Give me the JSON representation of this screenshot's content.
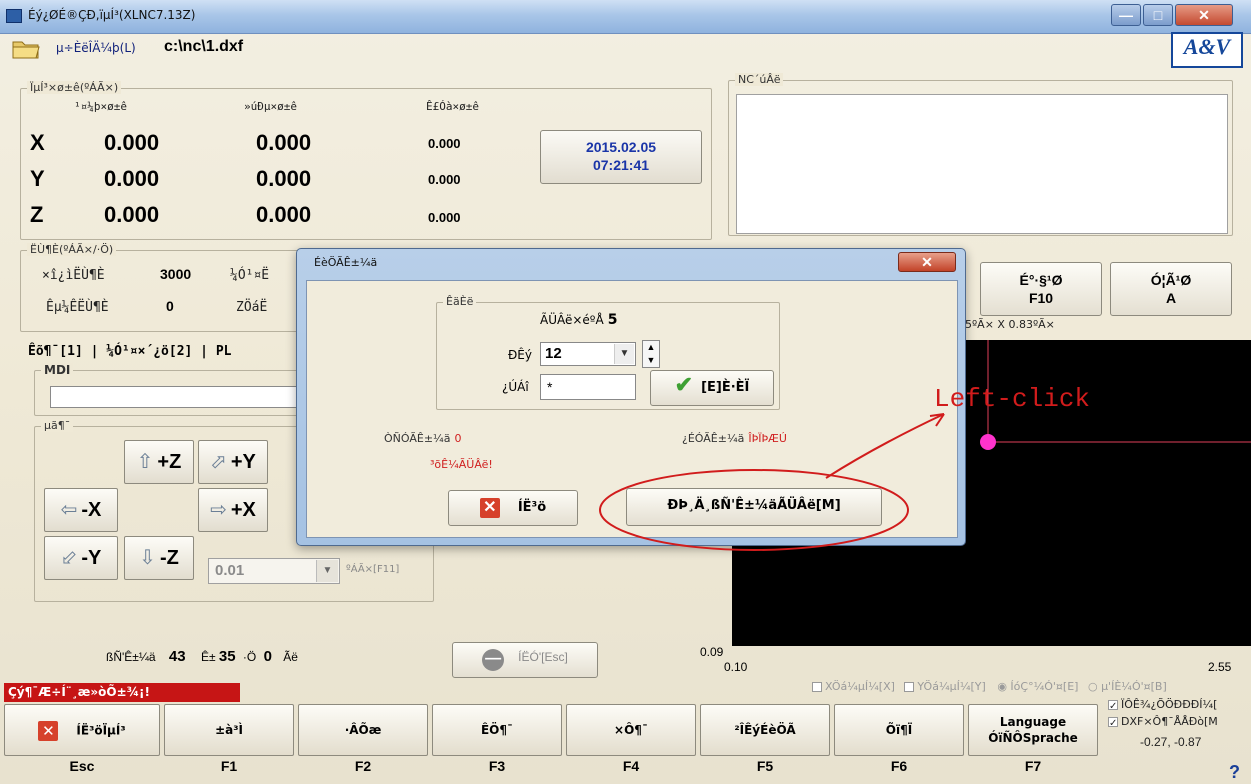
{
  "window": {
    "title": "Éý¿ØÉ®ÇÐ,ïµÍ³(XLNC7.13Z)",
    "btn_min": "—",
    "btn_max": "□",
    "btn_close": "✕"
  },
  "toolbar": {
    "open_file": "µ÷ÈëÎÄ¼þ(L)",
    "file_path": "c:\\nc\\1.dxf",
    "logo": "A&V"
  },
  "coords": {
    "group_title": "ÏµÍ³×ø±ê(ºÁÃ×)",
    "col1": "¹¤¼þ×ø±ê",
    "col2": "»úÐµ×ø±ê",
    "col3": "Ê£Óà×ø±ê",
    "rows": [
      {
        "axis": "X",
        "work": "0.000",
        "mach": "0.000",
        "remain": "0.000"
      },
      {
        "axis": "Y",
        "work": "0.000",
        "mach": "0.000",
        "remain": "0.000"
      },
      {
        "axis": "Z",
        "work": "0.000",
        "mach": "0.000",
        "remain": "0.000"
      }
    ]
  },
  "datetime": {
    "date": "2015.02.05",
    "time": "07:21:41"
  },
  "nc": {
    "group_title": "NC´úÂë",
    "code": ""
  },
  "speed": {
    "group_title": "ËÙ¶È(ºÁÃ×/·Ö)",
    "row1_label": "×î¿ìËÙ¶È",
    "row1_value": "3000",
    "row1b_label": "¼Ó¹¤Ë",
    "row2_label": "Êµ¼ÊËÙ¶È",
    "row2_value": "0",
    "row2b_label": "ZÖáË"
  },
  "right_buttons": {
    "b1_line1": "É°·§¹Ø",
    "b1_line2": "F10",
    "b2_line1": "Ó¦Ã¹Ø",
    "b2_line2": "A"
  },
  "tabs": {
    "label": "Êõ¶¯[1] | ¼Ó¹¤×´¿ö[2] | PL"
  },
  "mdi": {
    "group_title": "MDI",
    "value": ""
  },
  "jog": {
    "group_title": "µã¶¯",
    "z_plus": "+Z",
    "y_plus": "+Y",
    "x_minus": "-X",
    "x_plus": "+X",
    "y_minus": "-Y",
    "z_minus": "-Z",
    "step_value": "0.01",
    "step_unit": "ºÁÃ×[F11]"
  },
  "time_row": {
    "label1": "ßÑ'Ê±¼ä",
    "hours": "43",
    "label2": "Ê±",
    "minutes": "35",
    "label3": "·Ö",
    "seconds": "0",
    "label4": "Ãë"
  },
  "pause_btn": "ÍËÓ'[Esc]",
  "graphics": {
    "scale_text": "45ºÃ× X 0.83ºÃ×",
    "left_top": "0.09",
    "left_bottom": "0.10",
    "right_bottom": "2.55",
    "coords": "-0.27, -0.87"
  },
  "view_options": {
    "xview": "XÖá¼µÍ¼[X]",
    "yview": "YÖá¼µÍ¼[Y]",
    "top_view": "ÍóÇ°¼Ó'¤[E]",
    "iso_view": "µ'ÍÈ¼Ó'¤[B]",
    "opt1": "ÏÔÊ¾¿ÕÖÐÐÐÍ¼[",
    "opt2": "DXF×Ô¶¯ÅÅÐò[M"
  },
  "status": {
    "message": "Çý¶¯Æ÷Í¨¸æ»òÕ±¾¡!"
  },
  "fkeys": [
    {
      "label": "ÍË³öÏµÍ³",
      "key": "Esc"
    },
    {
      "label": "±à³Ì",
      "key": "F1"
    },
    {
      "label": "·ÂÕæ",
      "key": "F2"
    },
    {
      "label": "ÊÖ¶¯",
      "key": "F3"
    },
    {
      "label": "×Ô¶¯",
      "key": "F4"
    },
    {
      "label": "²ÎÊýÉèÖÃ",
      "key": "F5"
    },
    {
      "label": "Õï¶Ï",
      "key": "F6"
    },
    {
      "label": "Language",
      "label2": "ÓïÑÔSprache",
      "key": "F7"
    }
  ],
  "dialog": {
    "title": "ÉèÖÃÊ±¼ä",
    "close": "✕",
    "group_title": "ÊäÈë",
    "total_label": "ÃÜÂë×éºÅ",
    "total_value": "5",
    "count_label": "ÐÊý",
    "count_value": "12",
    "pwd_label": "¿ÚÁî",
    "pwd_value": "*",
    "confirm": "[E]È·ÈÏ",
    "runtime_label": "ÒÑÓÃÊ±¼ä",
    "runtime_value": "0",
    "expire_label": "¿ÉÓÃÊ±¼ä",
    "expire_value": "ÎÞÏÞÆÚ",
    "warning": "³õÊ¼ÃÜÂë!",
    "exit": "ÍË³ö",
    "modify": "ÐÞ¸Ä¸ßÑ'Ê±¼äÃÜÂë[M]"
  },
  "annotation": {
    "text": "Left-click",
    "color": "#d11c1c"
  }
}
